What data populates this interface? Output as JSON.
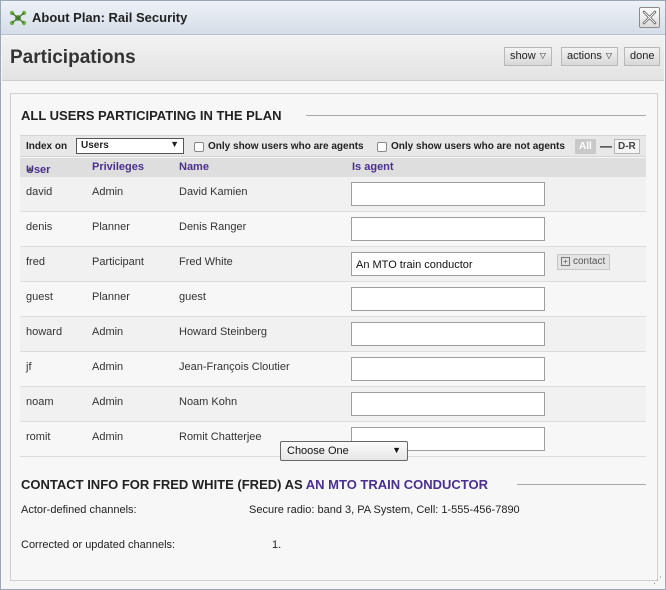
{
  "window": {
    "title": "About Plan: Rail Security",
    "close_icon": "close-x-icon",
    "app_icon": "network-gear-icon"
  },
  "header": {
    "title": "Participations",
    "buttons": [
      {
        "label": "show",
        "has_caret": true
      },
      {
        "label": "actions",
        "has_caret": true
      },
      {
        "label": "done",
        "has_caret": false
      }
    ]
  },
  "participants_section": {
    "heading": "ALL USERS PARTICIPATING IN THE PLAN",
    "filter": {
      "index_label": "Index on",
      "index_value": "Users",
      "only_agents": "Only show users who are agents",
      "only_non_agents": "Only show users who are not agents",
      "all_label": "All",
      "separator": "—",
      "range_label": "D-R"
    },
    "columns": {
      "user": "User",
      "privileges": "Privileges",
      "name": "Name",
      "is_agent": "Is agent",
      "sort_icon": "sort-ascending-icon"
    },
    "rows": [
      {
        "user": "david",
        "privileges": "Admin",
        "name": "David Kamien",
        "is_agent": ""
      },
      {
        "user": "denis",
        "privileges": "Planner",
        "name": "Denis Ranger",
        "is_agent": ""
      },
      {
        "user": "fred",
        "privileges": "Participant",
        "name": "Fred White",
        "is_agent": "An MTO train conductor",
        "action": "contact"
      },
      {
        "user": "guest",
        "privileges": "Planner",
        "name": "guest",
        "is_agent": ""
      },
      {
        "user": "howard",
        "privileges": "Admin",
        "name": "Howard Steinberg",
        "is_agent": ""
      },
      {
        "user": "jf",
        "privileges": "Admin",
        "name": "Jean-François Cloutier",
        "is_agent": ""
      },
      {
        "user": "noam",
        "privileges": "Admin",
        "name": "Noam Kohn",
        "is_agent": ""
      },
      {
        "user": "romit",
        "privileges": "Admin",
        "name": "Romit Chatterjee",
        "is_agent": ""
      }
    ]
  },
  "contact_section": {
    "heading_prefix": "CONTACT INFO FOR FRED WHITE (FRED) AS",
    "heading_accent": "AN MTO TRAIN CONDUCTOR",
    "actor_label": "Actor-defined channels:",
    "actor_value": "Secure radio: band 3, PA System, Cell: 1-555-456-7890",
    "corrected_label": "Corrected or updated channels:",
    "item_number": "1.",
    "choose_value": "Choose One"
  },
  "colors": {
    "accent_purple": "#4b2f8e",
    "title_bar": "#d5dde8",
    "row_alt": "#f1f1f1"
  }
}
